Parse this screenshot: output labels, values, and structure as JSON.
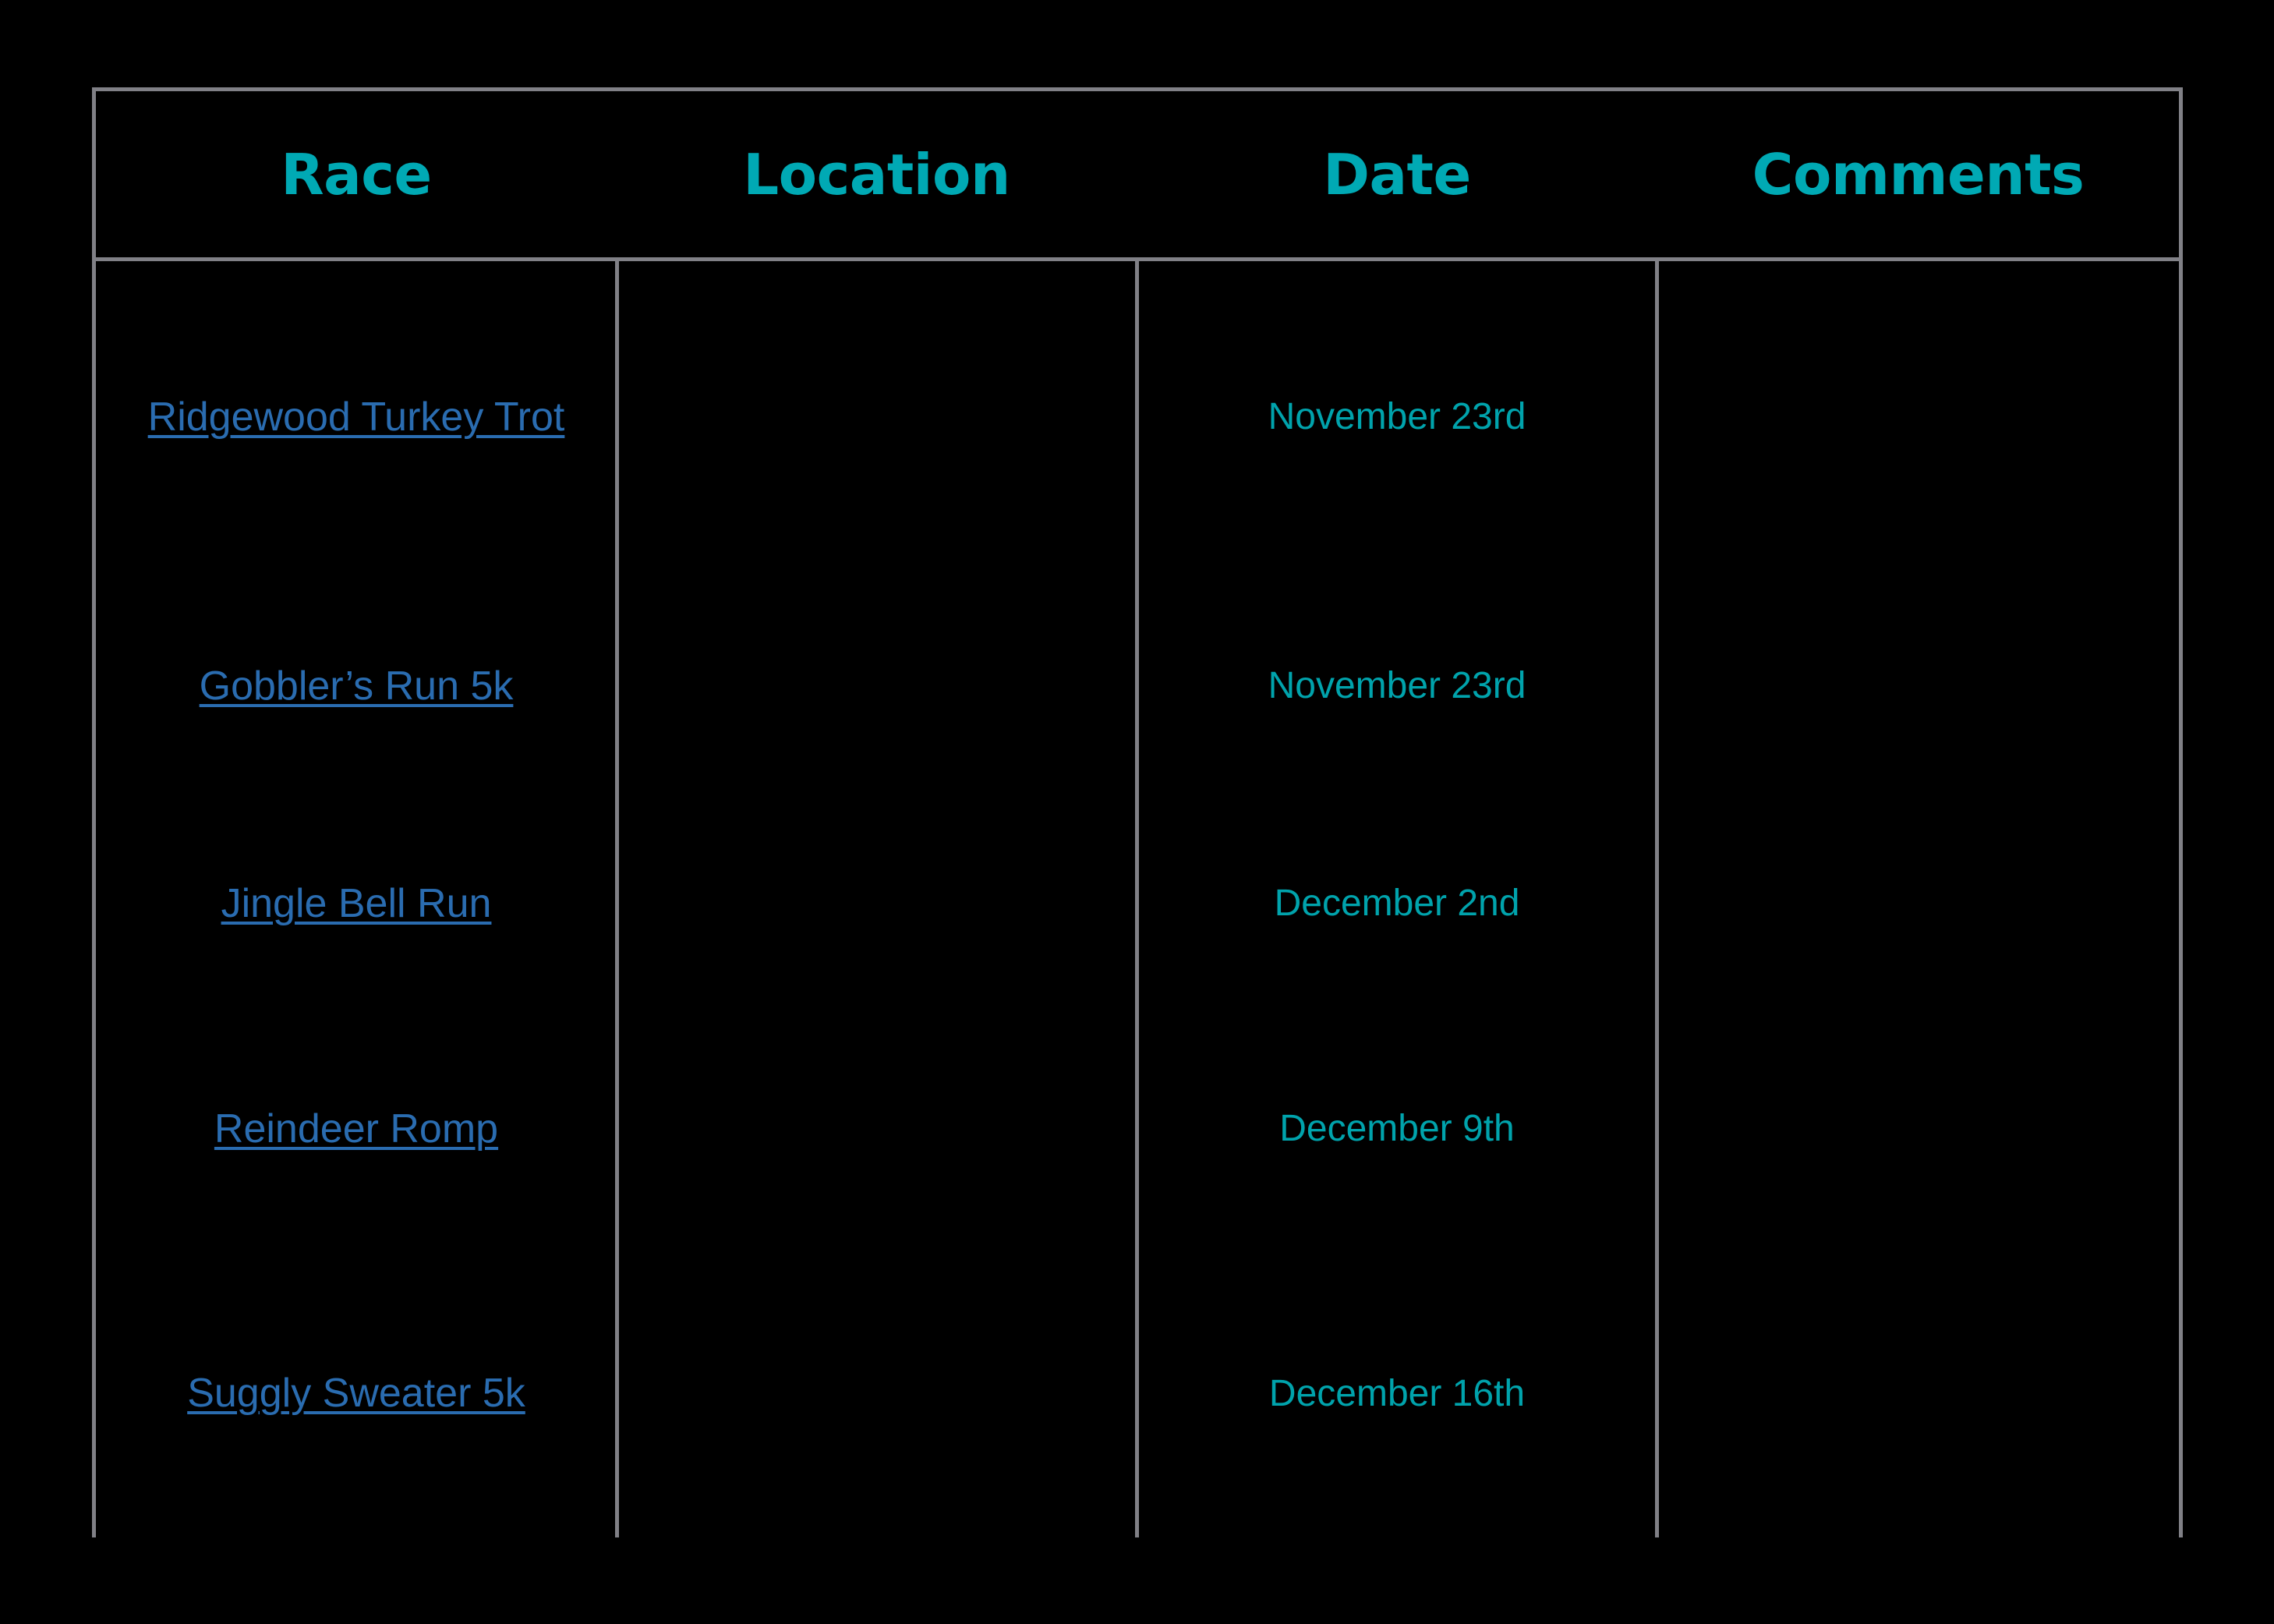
{
  "table": {
    "columns": [
      {
        "key": "race",
        "label": "Race"
      },
      {
        "key": "location",
        "label": "Location"
      },
      {
        "key": "date",
        "label": "Date"
      },
      {
        "key": "comments",
        "label": "Comments"
      }
    ],
    "rows": [
      {
        "race": "Ridgewood Turkey Trot",
        "race_is_link": true,
        "location": "",
        "date": "November 23rd",
        "comments": ""
      },
      {
        "race": "Gobbler’s Run 5k",
        "race_is_link": true,
        "location": "",
        "date": "November 23rd",
        "comments": ""
      },
      {
        "race": "Jingle Bell Run",
        "race_is_link": true,
        "location": "",
        "date": "December 2nd",
        "comments": ""
      },
      {
        "race": "Reindeer Romp",
        "race_is_link": true,
        "location": "",
        "date": "December 9th",
        "comments": ""
      },
      {
        "race": "Suggly Sweater 5k",
        "race_is_link": true,
        "location": "",
        "date": "December 16th",
        "comments": ""
      }
    ]
  },
  "colors": {
    "background": "#000000",
    "border": "#808086",
    "header_text": "#00A9B4",
    "link_text": "#2A6CB0",
    "date_text": "#00A3AC"
  }
}
